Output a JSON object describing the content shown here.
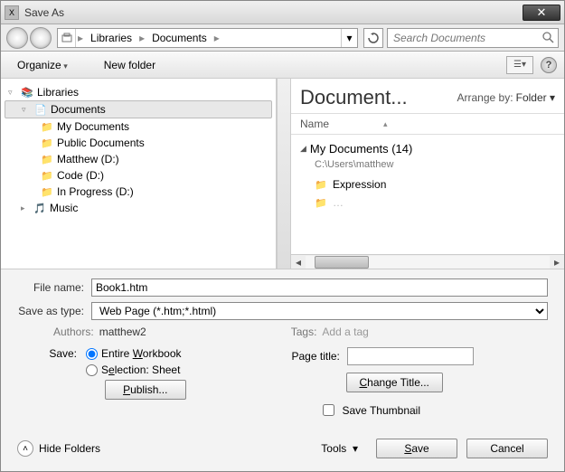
{
  "title": "Save As",
  "breadcrumb": {
    "part1": "Libraries",
    "part2": "Documents"
  },
  "search": {
    "placeholder": "Search Documents"
  },
  "toolbar": {
    "organize": "Organize",
    "newfolder": "New folder"
  },
  "navtree": {
    "root": "Libraries",
    "selected": "Documents",
    "children": [
      "My Documents",
      "Public Documents",
      "Matthew (D:)",
      "Code (D:)",
      "In Progress (D:)"
    ],
    "after": "Music"
  },
  "content": {
    "heading": "Document...",
    "arrange_label": "Arrange by:",
    "arrange_value": "Folder",
    "column": "Name",
    "group_name": "My Documents (14)",
    "group_path": "C:\\Users\\matthew",
    "items": [
      "Expression"
    ]
  },
  "form": {
    "filename_label": "File name:",
    "filename_value": "Book1.htm",
    "type_label": "Save as type:",
    "type_value": "Web Page (*.htm;*.html)",
    "authors_label": "Authors:",
    "authors_value": "matthew2",
    "tags_label": "Tags:",
    "tags_value": "Add a tag",
    "save_label": "Save:",
    "opt_workbook": "Entire Workbook",
    "opt_selection": "Selection: Sheet",
    "publish": "Publish...",
    "pagetitle_label": "Page title:",
    "pagetitle_value": "",
    "change_title": "Change Title...",
    "save_thumb": "Save Thumbnail"
  },
  "footer": {
    "hide_folders": "Hide Folders",
    "tools": "Tools",
    "save": "Save",
    "cancel": "Cancel"
  }
}
